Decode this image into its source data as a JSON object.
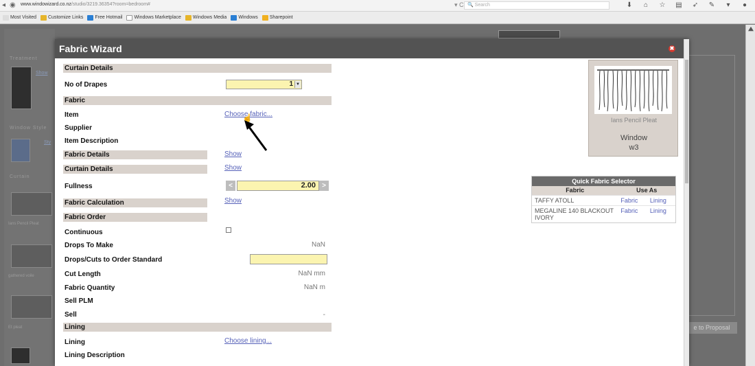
{
  "browser": {
    "url_host": "www.windowizard.co.nz",
    "url_path": "/studio/3219.36354?room=bedroom#",
    "search_placeholder": "Search",
    "bookmarks": [
      {
        "label": "Most Visited",
        "color": "#dddddd"
      },
      {
        "label": "Customize Links",
        "color": "#e6b52a"
      },
      {
        "label": "Free Hotmail",
        "color": "#2a7fd4"
      },
      {
        "label": "Windows Marketplace",
        "color": "#ffffff"
      },
      {
        "label": "Windows Media",
        "color": "#e6b52a"
      },
      {
        "label": "Windows",
        "color": "#2a7fd4"
      },
      {
        "label": "Sharepoint",
        "color": "#f0b020"
      }
    ]
  },
  "background": {
    "section_treatment": "Treatment",
    "section_window_style": "Window Style",
    "section_curtain": "Curtain",
    "link_show": "Show",
    "link_style": "Sty",
    "thumb_captions": [
      "Ians Pencil Pleat",
      "gathered voile",
      "Et pleat"
    ],
    "proposal_button": "e to Proposal"
  },
  "modal": {
    "title": "Fabric Wizard",
    "close_symbol": "✖",
    "sections": {
      "curtain_details": "Curtain Details",
      "fabric": "Fabric",
      "fabric_details": "Fabric Details",
      "curtain_details_2": "Curtain Details",
      "fabric_calculation": "Fabric Calculation",
      "fabric_order": "Fabric Order",
      "lining": "Lining"
    },
    "labels": {
      "no_of_drapes": "No of Drapes",
      "item": "Item",
      "supplier": "Supplier",
      "item_description": "Item Description",
      "fullness": "Fullness",
      "continuous": "Continuous",
      "drops_to_make": "Drops To Make",
      "drops_cuts_order": "Drops/Cuts to Order Standard",
      "cut_length": "Cut Length",
      "fabric_quantity": "Fabric Quantity",
      "sell_plm": "Sell PLM",
      "sell": "Sell",
      "lining": "Lining",
      "lining_description": "Lining Description"
    },
    "values": {
      "no_of_drapes": "1",
      "fullness": "2.00",
      "drops_to_make": "NaN",
      "cut_length": "NaN mm",
      "fabric_quantity": "NaN m",
      "sell": "-"
    },
    "links": {
      "choose_fabric": "Choose fabric...",
      "show_fabric_details": "Show",
      "show_curtain_details": "Show",
      "show_fabric_calculation": "Show",
      "choose_lining": "Choose lining..."
    },
    "stepper": {
      "minus": "<",
      "plus": ">"
    },
    "preview": {
      "caption": "Ians Pencil Pleat",
      "window_label": "Window",
      "window_id": "w3"
    },
    "quick_selector": {
      "title": "Quick Fabric Selector",
      "columns": [
        "Fabric",
        "Use As"
      ],
      "rows": [
        {
          "fabric": "TAFFY ATOLL",
          "fabric_action": "Fabric",
          "lining_action": "Lining"
        },
        {
          "fabric": "MEGALINE 140 BLACKOUT IVORY",
          "fabric_action": "Fabric",
          "lining_action": "Lining"
        }
      ]
    }
  }
}
